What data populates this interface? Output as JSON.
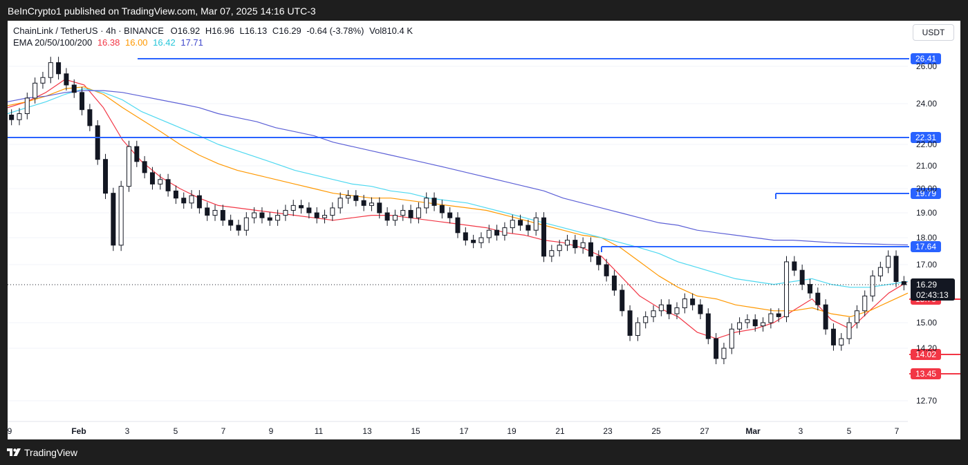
{
  "header_text": "BeInCrypto1 published on TradingView.com, Mar 07, 2025 14:16 UTC-3",
  "footer_brand": "TradingView",
  "currency_button": "USDT",
  "symbol_line": {
    "symbol": "ChainLink / TetherUS · 4h · BINANCE",
    "open_label": "O",
    "open": "16.92",
    "high_label": "H",
    "high": "16.96",
    "low_label": "L",
    "low": "16.13",
    "close_label": "C",
    "close": "16.29",
    "change": "-0.64 (-3.78%)",
    "volume_label": "Vol",
    "volume": "810.4 K"
  },
  "ema_line": {
    "label": "EMA 20/50/100/200",
    "ema20": "16.38",
    "ema50": "16.00",
    "ema100": "16.42",
    "ema200": "17.71"
  },
  "colors": {
    "background": "#ffffff",
    "frame": "#1e1e1e",
    "candle": "#131722",
    "ema20": "#f23645",
    "ema50": "#ff9800",
    "ema100": "#4dd8f0",
    "ema200": "#5b5fd6",
    "resistance": "#2962ff",
    "support": "#f23645",
    "label_text": "#ffffff",
    "axis_text": "#131722"
  },
  "chart_data": {
    "type": "candlestick",
    "title": "ChainLink / TetherUS · 4h · BINANCE",
    "y_ticks": [
      "26.00",
      "24.00",
      "22.00",
      "21.00",
      "20.00",
      "19.00",
      "18.00",
      "17.00",
      "15.00",
      "14.20",
      "12.70"
    ],
    "x_ticks": [
      "9",
      "Feb",
      "3",
      "5",
      "7",
      "9",
      "11",
      "13",
      "15",
      "17",
      "19",
      "21",
      "23",
      "25",
      "27",
      "Mar",
      "3",
      "5",
      "7"
    ],
    "price_levels": [
      {
        "label": "26.41",
        "value": 26.41,
        "type": "resistance",
        "start": "Feb 1"
      },
      {
        "label": "22.31",
        "value": 22.31,
        "type": "resistance",
        "start": "Jan 30"
      },
      {
        "label": "19.79",
        "value": 19.79,
        "type": "resistance",
        "start": "Feb 17"
      },
      {
        "label": "17.64",
        "value": 17.64,
        "type": "resistance",
        "start": "Feb 12"
      },
      {
        "label": "15.79",
        "value": 15.79,
        "type": "support",
        "start": "Feb 27"
      },
      {
        "label": "14.02",
        "value": 14.02,
        "type": "support",
        "start": "Feb 25"
      },
      {
        "label": "13.45",
        "value": 13.45,
        "type": "support",
        "start": "Feb 28"
      }
    ],
    "last_price": {
      "value": 16.29,
      "label": "16.29",
      "countdown": "02:43:13"
    },
    "ema_periods": [
      20,
      50,
      100,
      200
    ],
    "ema_series": [
      {
        "name": "EMA 20",
        "values": [
          23.8,
          24.1,
          24.6,
          25.3,
          25.0,
          23.8,
          22.2,
          21.2,
          20.5,
          20.0,
          19.6,
          19.3,
          19.2,
          19.1,
          19.0,
          18.9,
          18.8,
          18.7,
          18.8,
          18.9,
          18.9,
          18.8,
          18.7,
          18.6,
          18.5,
          18.4,
          18.2,
          18.1,
          17.9,
          17.8,
          17.6,
          17.3,
          16.6,
          15.9,
          15.5,
          15.2,
          14.7,
          14.5,
          14.7,
          14.8,
          15.0,
          15.4,
          15.8,
          15.1,
          14.8,
          15.4,
          16.0,
          16.4
        ]
      },
      {
        "name": "EMA 50",
        "values": [
          23.9,
          24.1,
          24.4,
          24.8,
          24.9,
          24.5,
          23.8,
          23.2,
          22.6,
          22.0,
          21.5,
          21.1,
          20.8,
          20.6,
          20.4,
          20.2,
          20.0,
          19.8,
          19.7,
          19.6,
          19.6,
          19.5,
          19.4,
          19.3,
          19.2,
          19.1,
          18.9,
          18.7,
          18.5,
          18.3,
          18.1,
          18.0,
          17.6,
          17.1,
          16.6,
          16.2,
          15.9,
          15.8,
          15.6,
          15.5,
          15.4,
          15.4,
          15.5,
          15.3,
          15.2,
          15.4,
          15.7,
          16.0
        ]
      },
      {
        "name": "EMA 100",
        "values": [
          23.5,
          23.8,
          24.1,
          24.5,
          24.8,
          24.6,
          24.2,
          23.6,
          23.2,
          22.8,
          22.4,
          22.0,
          21.7,
          21.4,
          21.1,
          20.8,
          20.6,
          20.4,
          20.2,
          20.1,
          19.9,
          19.8,
          19.6,
          19.5,
          19.4,
          19.2,
          19.0,
          18.8,
          18.6,
          18.4,
          18.2,
          18.0,
          17.8,
          17.6,
          17.4,
          17.1,
          16.9,
          16.7,
          16.5,
          16.4,
          16.3,
          16.4,
          16.5,
          16.3,
          16.2,
          16.2,
          16.3,
          16.4
        ]
      },
      {
        "name": "EMA 200",
        "values": [
          24.1,
          24.3,
          24.4,
          24.6,
          24.7,
          24.7,
          24.6,
          24.4,
          24.2,
          24.0,
          23.8,
          23.5,
          23.3,
          23.1,
          22.8,
          22.6,
          22.4,
          22.1,
          21.9,
          21.7,
          21.5,
          21.3,
          21.1,
          20.9,
          20.7,
          20.5,
          20.3,
          20.1,
          19.9,
          19.6,
          19.4,
          19.2,
          19.0,
          18.8,
          18.6,
          18.5,
          18.3,
          18.2,
          18.1,
          18.0,
          17.9,
          17.9,
          17.85,
          17.8,
          17.77,
          17.75,
          17.73,
          17.71
        ]
      }
    ],
    "close_series": [
      23.2,
      23.5,
      24.3,
      25.1,
      25.4,
      26.2,
      25.6,
      25.0,
      24.6,
      23.7,
      22.9,
      21.3,
      19.8,
      17.7,
      20.1,
      21.9,
      21.2,
      20.7,
      20.2,
      20.4,
      19.9,
      19.6,
      19.4,
      19.7,
      19.2,
      18.9,
      19.1,
      18.7,
      18.5,
      18.3,
      18.8,
      19.0,
      18.8,
      18.7,
      18.9,
      19.1,
      19.3,
      19.2,
      19.0,
      18.8,
      18.9,
      19.2,
      19.6,
      19.7,
      19.5,
      19.3,
      19.4,
      19.0,
      18.7,
      18.9,
      19.1,
      18.8,
      19.2,
      19.6,
      19.3,
      19.0,
      18.8,
      18.2,
      17.9,
      17.8,
      18.0,
      18.3,
      18.1,
      18.4,
      18.7,
      18.5,
      18.3,
      18.8,
      17.3,
      17.5,
      17.7,
      17.9,
      17.6,
      17.8,
      17.3,
      17.0,
      16.6,
      16.1,
      15.4,
      14.6,
      15.0,
      15.2,
      15.4,
      15.6,
      15.3,
      15.5,
      15.8,
      15.6,
      15.3,
      14.5,
      13.9,
      14.2,
      14.8,
      15.0,
      15.1,
      14.9,
      15.0,
      15.3,
      15.2,
      17.1,
      16.8,
      16.3,
      16.0,
      15.6,
      14.8,
      14.3,
      14.5,
      15.0,
      15.4,
      15.9,
      16.6,
      16.9,
      17.3,
      16.4,
      16.29
    ],
    "xlabel": "",
    "ylabel": ""
  }
}
